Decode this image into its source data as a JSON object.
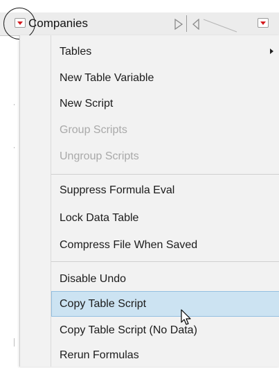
{
  "header": {
    "title": "Companies",
    "left_arrow_icon": "red-dropdown-arrow-icon",
    "right_arrow_icon": "red-dropdown-arrow-icon",
    "accent_red": "#d4191e"
  },
  "menu": {
    "items": [
      {
        "label": "Tables",
        "enabled": true,
        "submenu": true
      },
      {
        "label": "New Table Variable",
        "enabled": true
      },
      {
        "label": "New Script",
        "enabled": true
      },
      {
        "label": "Group Scripts",
        "enabled": false
      },
      {
        "label": "Ungroup Scripts",
        "enabled": false
      },
      {
        "label": "Suppress Formula Eval",
        "enabled": true
      },
      {
        "label": "Lock Data Table",
        "enabled": true
      },
      {
        "label": "Compress File When Saved",
        "enabled": true
      },
      {
        "label": "Disable Undo",
        "enabled": true
      },
      {
        "label": "Copy Table Script",
        "enabled": true,
        "hovered": true
      },
      {
        "label": "Copy Table Script (No Data)",
        "enabled": true
      },
      {
        "label": "Rerun Formulas",
        "enabled": true
      }
    ],
    "hover_color": "#cce3f2",
    "disabled_color": "#a9a9a9"
  }
}
